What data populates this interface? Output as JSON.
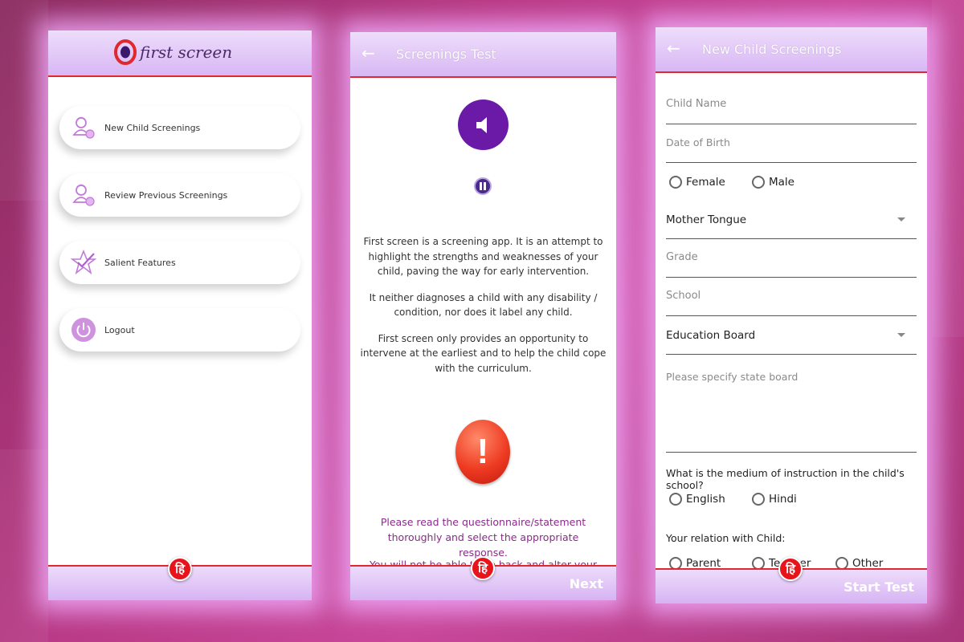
{
  "screen1": {
    "logo_text": "first screen",
    "menu": [
      {
        "label": "New Child Screenings",
        "icon": "child-profile-icon"
      },
      {
        "label": "Review Previous Screenings",
        "icon": "child-profile-icon"
      },
      {
        "label": "Salient Features",
        "icon": "star-check-icon"
      },
      {
        "label": "Logout",
        "icon": "power-icon"
      }
    ],
    "hindi_label": "हि"
  },
  "screen2": {
    "title": "Screenings Test",
    "paragraphs": [
      "First screen is a screening app. It is an attempt to highlight the strengths and weaknesses of your child, paving the way for early intervention.",
      "It neither diagnoses a child with any disability / condition, nor does it label any child.",
      "First screen only provides an opportunity to intervene at the earliest and to help the child cope with the curriculum."
    ],
    "instruction": "Please read the questionnaire/statement thoroughly and select the appropriate response.",
    "instruction_cut": "You will not be able to go back and alter your response",
    "next_label": "Next",
    "hindi_label": "हि"
  },
  "screen3": {
    "title": "New Child Screenings",
    "child_name_placeholder": "Child Name",
    "dob_placeholder": "Date of Birth",
    "gender_options": [
      "Female",
      "Male"
    ],
    "mother_tongue_value": "Mother Tongue",
    "grade_placeholder": "Grade",
    "school_placeholder": "School",
    "education_board_value": "Education Board",
    "state_board_placeholder": "Please specify state board",
    "medium_question": "What is the medium of instruction in the child's school?",
    "medium_options": [
      "English",
      "Hindi"
    ],
    "relation_question": "Your relation with Child:",
    "relation_options": [
      "Parent",
      "Teacher",
      "Other"
    ],
    "start_label": "Start Test",
    "hindi_label": "हि"
  },
  "colors": {
    "accent_red": "#e0282f",
    "brand_purple": "#6a1aa6",
    "bar_lavender": "#d8b7f4",
    "instruction_purple": "#8b2a8b"
  }
}
